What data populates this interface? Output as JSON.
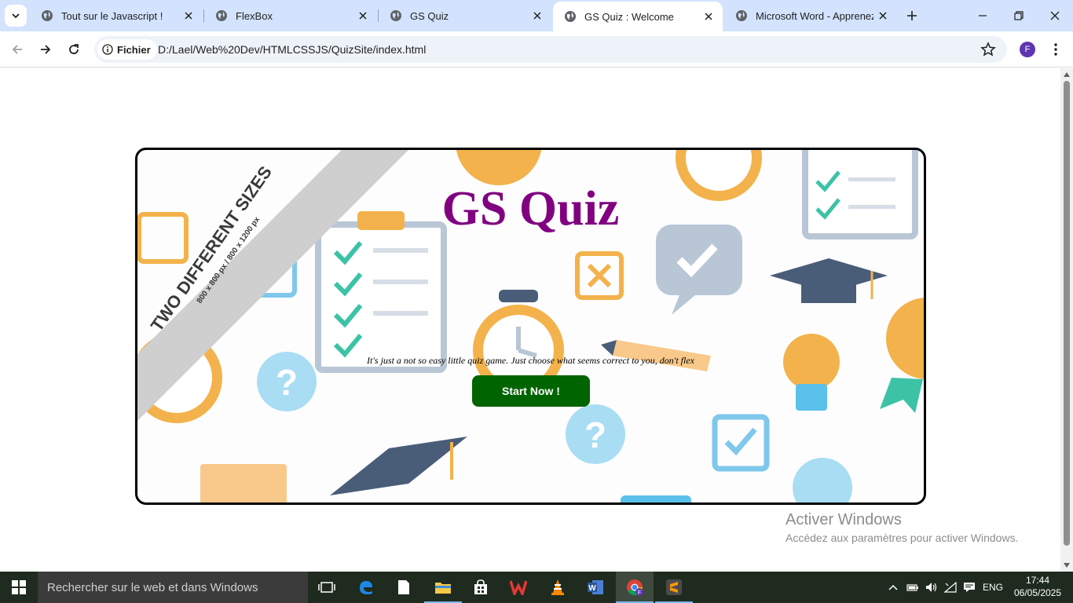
{
  "browser": {
    "tabs": [
      {
        "title": "Tout sur le Javascript !",
        "active": false
      },
      {
        "title": "FlexBox",
        "active": false
      },
      {
        "title": "GS Quiz",
        "active": false
      },
      {
        "title": "GS Quiz : Welcome",
        "active": true
      },
      {
        "title": "Microsoft Word - Apprenez_",
        "active": false
      }
    ],
    "security_chip_label": "Fichier",
    "url": "D:/Lael/Web%20Dev/HTMLCSSJS/QuizSite/index.html",
    "profile_initial": "F"
  },
  "page": {
    "title": "GS Quiz",
    "tagline": "It's just a not so easy little quiz game. Just choose what seems correct to you, don't flex",
    "start_button_label": "Start Now !",
    "banner_text": "TWO DIFFERENT SIZES",
    "banner_subtext": "800 x 800 px / 800 x 1200 px"
  },
  "watermark": {
    "title": "Activer Windows",
    "subtitle": "Accédez aux paramètres pour activer Windows."
  },
  "taskbar": {
    "search_placeholder": "Rechercher sur le web et dans Windows",
    "language": "ENG",
    "time": "17:44",
    "date": "06/05/2025",
    "apps": [
      "task-view",
      "edge",
      "notepad",
      "file-explorer",
      "store",
      "wps",
      "vlc",
      "word",
      "chrome",
      "sublime-text"
    ]
  },
  "colors": {
    "tabstrip": "#d3e3fd",
    "title_purple": "#800080",
    "button_green": "#006400",
    "taskbar": "#1f2b1f"
  }
}
